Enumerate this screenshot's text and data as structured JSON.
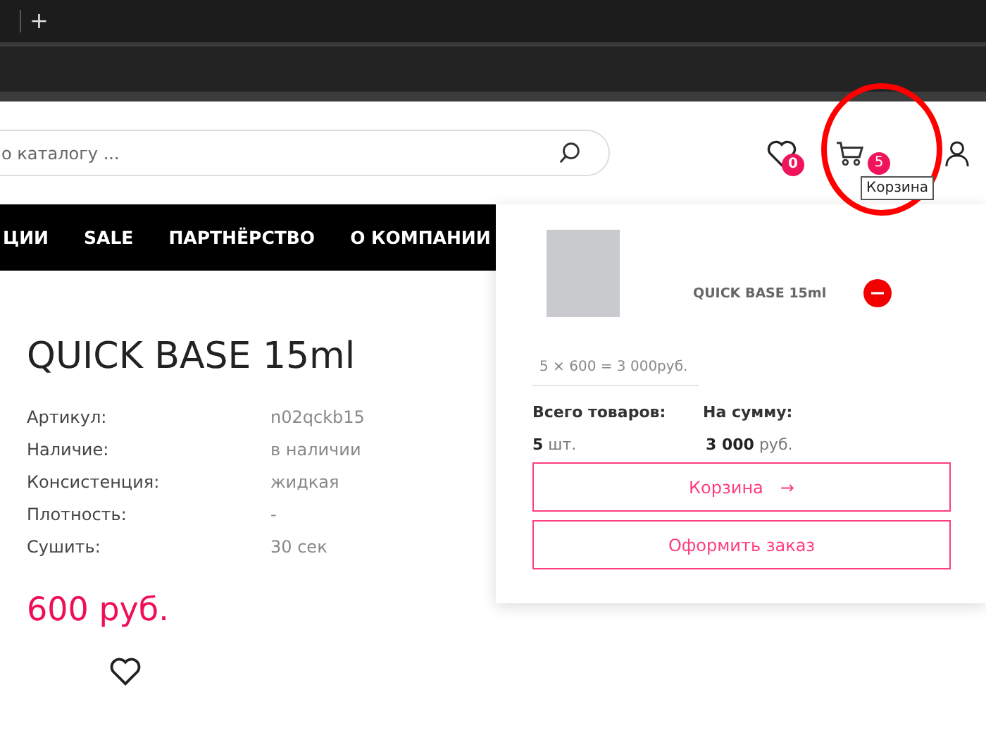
{
  "browser": {
    "new_tab": "+"
  },
  "header": {
    "search": {
      "placeholder": "о каталогу ..."
    },
    "wishlist": {
      "count": "0"
    },
    "cart": {
      "count": "5",
      "tooltip": "Корзина"
    }
  },
  "nav": [
    {
      "label": "ЦИИ"
    },
    {
      "label": "SALE"
    },
    {
      "label": "ПАРТНЁРСТВО"
    },
    {
      "label": "О КОМПАНИИ"
    }
  ],
  "product": {
    "title": "QUICK BASE 15ml",
    "specs": [
      {
        "label": "Артикул:",
        "value": "n02qckb15"
      },
      {
        "label": "Наличие:",
        "value": "в наличии"
      },
      {
        "label": "Консистенция:",
        "value": "жидкая"
      },
      {
        "label": "Плотность:",
        "value": "-"
      },
      {
        "label": "Сушить:",
        "value": "30 сек"
      }
    ],
    "price": "600 руб."
  },
  "cart_dropdown": {
    "items": [
      {
        "name": "QUICK BASE 15ml",
        "calc": "5 × 600 = 3 000руб."
      }
    ],
    "total_items_label": "Всего товаров:",
    "total_items": "**5** шт.",
    "sum_label": "На сумму:",
    "sum": "**3 000** руб.",
    "buttons": [
      {
        "label": "Корзина",
        "arrow": "→"
      },
      {
        "label": "Оформить заказ"
      }
    ]
  }
}
